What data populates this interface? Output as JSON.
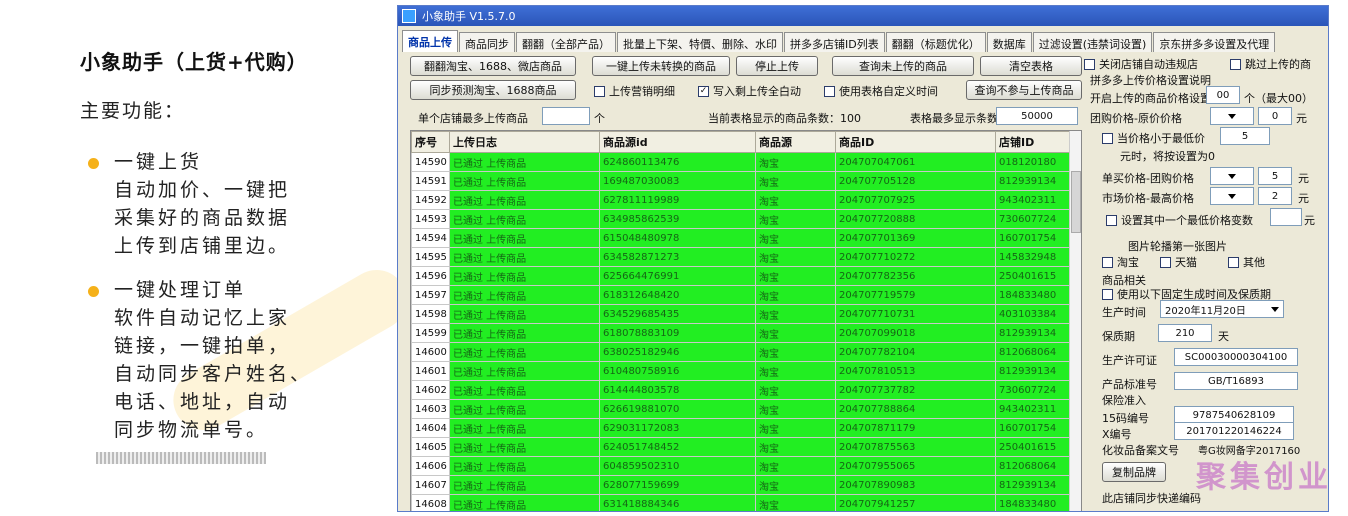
{
  "intro": {
    "title": "小象助手（上货+代购）",
    "subtitle": "主要功能：",
    "features": [
      {
        "head": "一键上货",
        "lines": [
          "自动加价、一键把",
          "采集好的商品数据",
          "上传到店铺里边。"
        ]
      },
      {
        "head": "一键处理订单",
        "lines": [
          "软件自动记忆上家",
          "链接，一键拍单，",
          "自动同步客户姓名、",
          "电话、地址，自动",
          "同步物流单号。"
        ]
      }
    ],
    "accent": "#f5b11a"
  },
  "window": {
    "title": "小象助手 V1.5.7.0",
    "tabs": [
      "商品上传",
      "商品同步",
      "翻翻（全部产品）",
      "批量上下架、特價、删除、水印",
      "拼多多店铺ID列表",
      "翻翻（标题优化）",
      "数据库",
      "过滤设置(违禁词设置)",
      "京东拼多多设置及代理"
    ],
    "buttons": {
      "b1": "翻翻淘宝、1688、微店商品",
      "b2": "一键上传未转换的商品",
      "b3": "停止上传",
      "b4": "查询未上传的商品",
      "b5": "清空表格",
      "b6": "同步预测淘宝、1688商品",
      "b7": "查询不参与上传商品",
      "b8": "复制品牌"
    },
    "checks": {
      "c1": "上传营销明细",
      "c2": "写入剩上传全白动",
      "c3": "使用表格自定义时间"
    },
    "row3": {
      "label1": "单个店铺最多上传商品",
      "unit1": "个",
      "label2": "当前表格显示的商品条数：100",
      "label3": "表格最多显示条数",
      "value3": "50000"
    }
  },
  "grid": {
    "headers": [
      "序号",
      "上传日志",
      "商品源id",
      "商品源",
      "商品ID",
      "店铺ID"
    ],
    "rows": [
      [
        "14590",
        "已通过  上传商品",
        "624860113476",
        "淘宝",
        "204707047061",
        "018120180"
      ],
      [
        "14591",
        "已通过  上传商品",
        "169487030083",
        "淘宝",
        "204707705128",
        "812939134"
      ],
      [
        "14592",
        "已通过  上传商品",
        "627811119989",
        "淘宝",
        "204707707925",
        "943402311"
      ],
      [
        "14593",
        "已通过  上传商品",
        "634985862539",
        "淘宝",
        "204707720888",
        "730607724"
      ],
      [
        "14594",
        "已通过  上传商品",
        "615048480978",
        "淘宝",
        "204707701369",
        "160701754"
      ],
      [
        "14595",
        "已通过  上传商品",
        "634582871273",
        "淘宝",
        "204707710272",
        "145832948"
      ],
      [
        "14596",
        "已通过  上传商品",
        "625664476991",
        "淘宝",
        "204707782356",
        "250401615"
      ],
      [
        "14597",
        "已通过  上传商品",
        "618312648420",
        "淘宝",
        "204707719579",
        "184833480"
      ],
      [
        "14598",
        "已通过  上传商品",
        "634529685435",
        "淘宝",
        "204707710731",
        "403103384"
      ],
      [
        "14599",
        "已通过  上传商品",
        "618078883109",
        "淘宝",
        "204707099018",
        "812939134"
      ],
      [
        "14600",
        "已通过  上传商品",
        "638025182946",
        "淘宝",
        "204707782104",
        "812068064"
      ],
      [
        "14601",
        "已通过  上传商品",
        "610480758916",
        "淘宝",
        "204707810513",
        "812939134"
      ],
      [
        "14602",
        "已通过  上传商品",
        "614444803578",
        "淘宝",
        "204707737782",
        "730607724"
      ],
      [
        "14603",
        "已通过  上传商品",
        "626619881070",
        "淘宝",
        "204707788864",
        "943402311"
      ],
      [
        "14604",
        "已通过  上传商品",
        "629031172083",
        "淘宝",
        "204707871179",
        "160701754"
      ],
      [
        "14605",
        "已通过  上传商品",
        "624051748452",
        "淘宝",
        "204707875563",
        "250401615"
      ],
      [
        "14606",
        "已通过  上传商品",
        "604859502310",
        "淘宝",
        "204707955065",
        "812068064"
      ],
      [
        "14607",
        "已通过  上传商品",
        "628077159699",
        "淘宝",
        "204707890983",
        "812939134"
      ],
      [
        "14608",
        "已通过  上传商品",
        "631418884346",
        "淘宝",
        "204707941257",
        "184833480"
      ]
    ]
  },
  "right": {
    "c_close_shop": "关闭店铺自动违规店",
    "c_repeat": "跳过上传的商",
    "pdd_title": "拼多多上传价格设置说明",
    "open_label": "开启上传的商品价格设置",
    "open_value": "00",
    "open_unit": "个（最大00）",
    "group_label": "团购价格-原价价格",
    "group_value": "0",
    "group_unit": "元",
    "c_price": "当价格小于最低价",
    "price_value": "5",
    "price_note": "元时，将按设置为0",
    "single_label": "单买价格-团购价格",
    "single_value": "5",
    "single_unit": "元",
    "market_label": "市场价格-最高价格",
    "market_value": "2",
    "market_unit": "元",
    "c_set_one": "设置其中一个最低价格变数",
    "set_unit": "元",
    "cover_title": "图片轮播第一张图片",
    "cover_opts": [
      "淘宝",
      "天猫",
      "其他"
    ],
    "product_title": "商品相关",
    "c_custom": "使用以下固定生成时间及保质期",
    "prod_time_label": "生产时间",
    "prod_time_value": "2020年11月20日",
    "shelf_label": "保质期",
    "shelf_value": "210",
    "shelf_unit": "天",
    "license_label": "生产许可证",
    "license_value": "SC00030000304100",
    "std_label": "产品标准号",
    "std_value": "GB/T16893",
    "reg_label": "保险准入",
    "id15_label": "15码编号",
    "id15_value": "9787540628109",
    "code_label": "X编号",
    "code_value": "201701220146224",
    "cosmetic_label": "化妆品备案文号",
    "cosmetic_value": "粤G妆网备字2017160",
    "final_title": "此店铺同步快递编码"
  },
  "watermark": "聚集创业"
}
